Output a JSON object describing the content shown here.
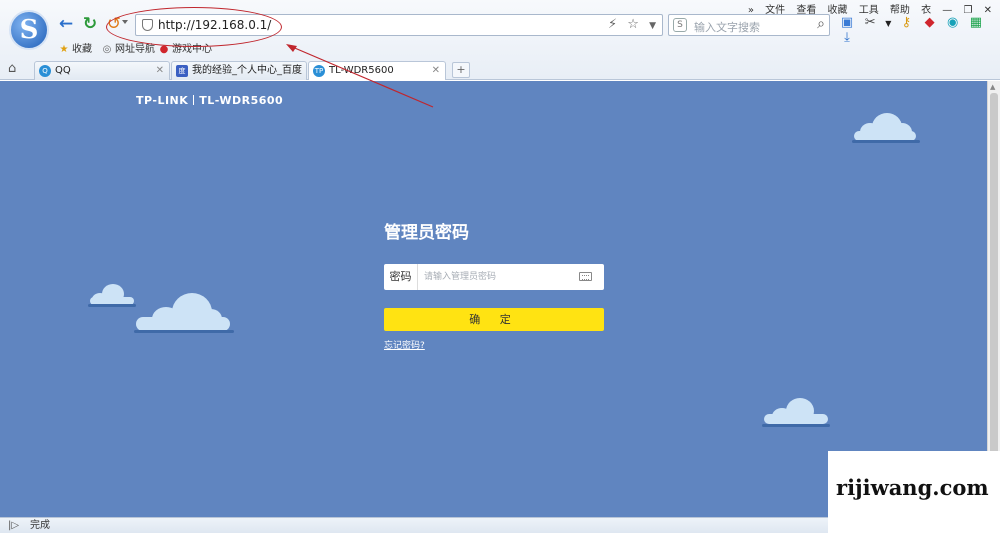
{
  "browser": {
    "address": "http://192.168.0.1/",
    "search_placeholder": "输入文字搜索",
    "menu": [
      "»",
      "文件",
      "查看",
      "收藏",
      "工具",
      "帮助"
    ],
    "window_controls": [
      "衣",
      "—",
      "❐",
      "✕"
    ],
    "bookmarks": [
      "收藏",
      "网址导航",
      "游戏中心"
    ],
    "tabs": [
      {
        "label": "QQ",
        "active": false
      },
      {
        "label": "我的经验_个人中心_百度",
        "active": false
      },
      {
        "label": "TL-WDR5600",
        "active": true
      }
    ],
    "new_tab": "+",
    "status": "完成"
  },
  "page": {
    "brand": "TP-LINK",
    "model": "TL-WDR5600",
    "title": "管理员密码",
    "password_label": "密码",
    "password_placeholder": "请输入管理员密码",
    "confirm": "确 定",
    "forgot": "忘记密码?"
  },
  "watermark": "rijiwang.com",
  "colors": {
    "page_bg": "#6085c0",
    "button": "#ffe312",
    "cloud": "#cde3f6",
    "annotation": "#c0262d"
  },
  "icons": {
    "back": "arrow-left-icon",
    "refresh": "refresh-icon",
    "shield": "shield-icon",
    "keyboard": "keyboard-icon"
  }
}
